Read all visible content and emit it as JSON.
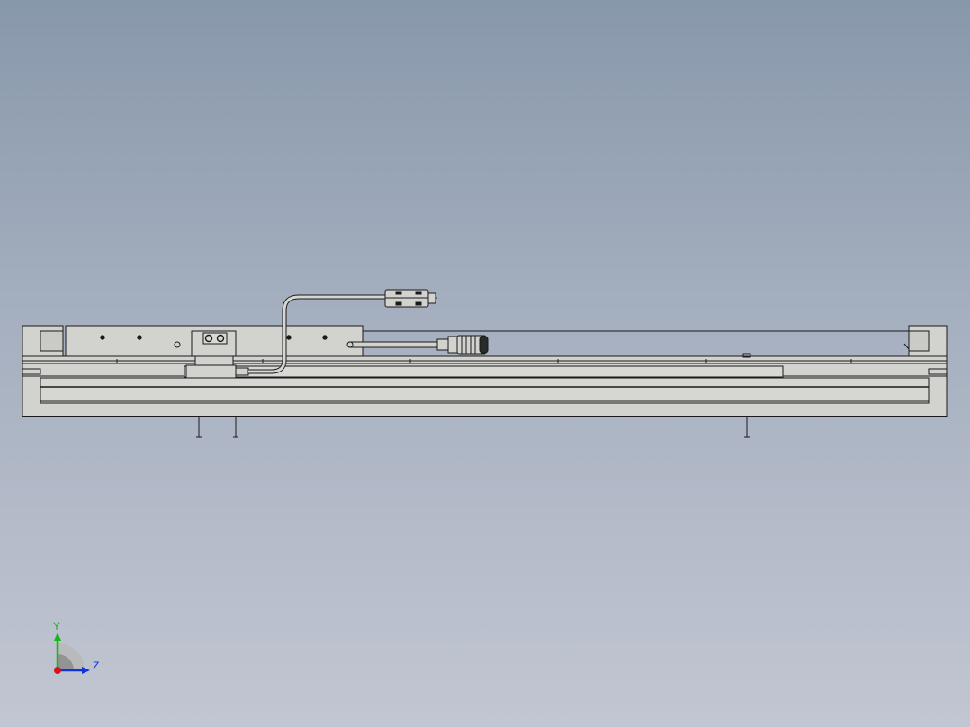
{
  "window": {
    "title": ""
  },
  "colors": {
    "background_top": "#8898ab",
    "background_bottom": "#c2c6d2",
    "part_fill": "#d2d2ce",
    "part_stroke": "#1a1a1a",
    "axis_x": "#dd1111",
    "axis_y": "#11bb11",
    "axis_z": "#1133dd"
  },
  "triad": {
    "y_label": "Y",
    "z_label": "Z"
  },
  "model": {
    "view": "side-view",
    "components": [
      "linear-actuator-base",
      "slider-carriage",
      "motor-cable",
      "cable-connector",
      "motor-connector",
      "end-cap-left",
      "end-cap-right"
    ]
  }
}
